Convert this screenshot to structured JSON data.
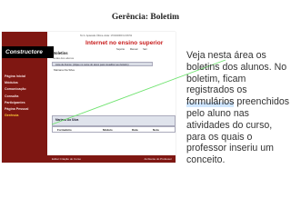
{
  "slide": {
    "title": "Gerência: Boletim",
    "description_before": "Veja nesta área os boletins dos alunos. No boletim, ficam registrados os ",
    "description_highlight": "formulários",
    "description_after": " preenchidos pelo aluno nas atividades do curso, para os quais o professor inseriu um conceito."
  },
  "screenshot": {
    "brand": "Constructore",
    "user_info": "Tel 4. Apiacatis   Última visita: 17/04/2009 12:06:51",
    "header_logo": "Internet no ensino superior",
    "top_links": [
      "Suporte",
      "Manual",
      "Sair"
    ],
    "menu": [
      {
        "label": "Página Inicial",
        "active": false
      },
      {
        "label": "Módulos",
        "active": false
      },
      {
        "label": "Comunicação",
        "active": false
      },
      {
        "label": "Consulta",
        "active": false
      },
      {
        "label": "Participantes",
        "active": false
      },
      {
        "label": "Página Pessoal",
        "active": false
      },
      {
        "label": "Gerência",
        "active": true
      }
    ],
    "section_title": "Boletins",
    "section_subtitle": "Notas dos alunos",
    "list_label": "Lista de Alunos: (clique no nome do aluno para visualizar seu boletim)",
    "list_value": "Mariana Da Silva",
    "student_name": "Mariana Da Silva",
    "table_headers": [
      "Formulário",
      "Módulo",
      "Data",
      "Nota"
    ],
    "footer_left": "Editar Criação do Curso",
    "footer_right": "Ambiente do Professor"
  },
  "colors": {
    "sidebar": "#7f1712",
    "active_menu": "#ffcf38",
    "header_logo": "#c81c1c",
    "pointer_line": "#6fe36f",
    "highlight": "#cfe6ff"
  }
}
